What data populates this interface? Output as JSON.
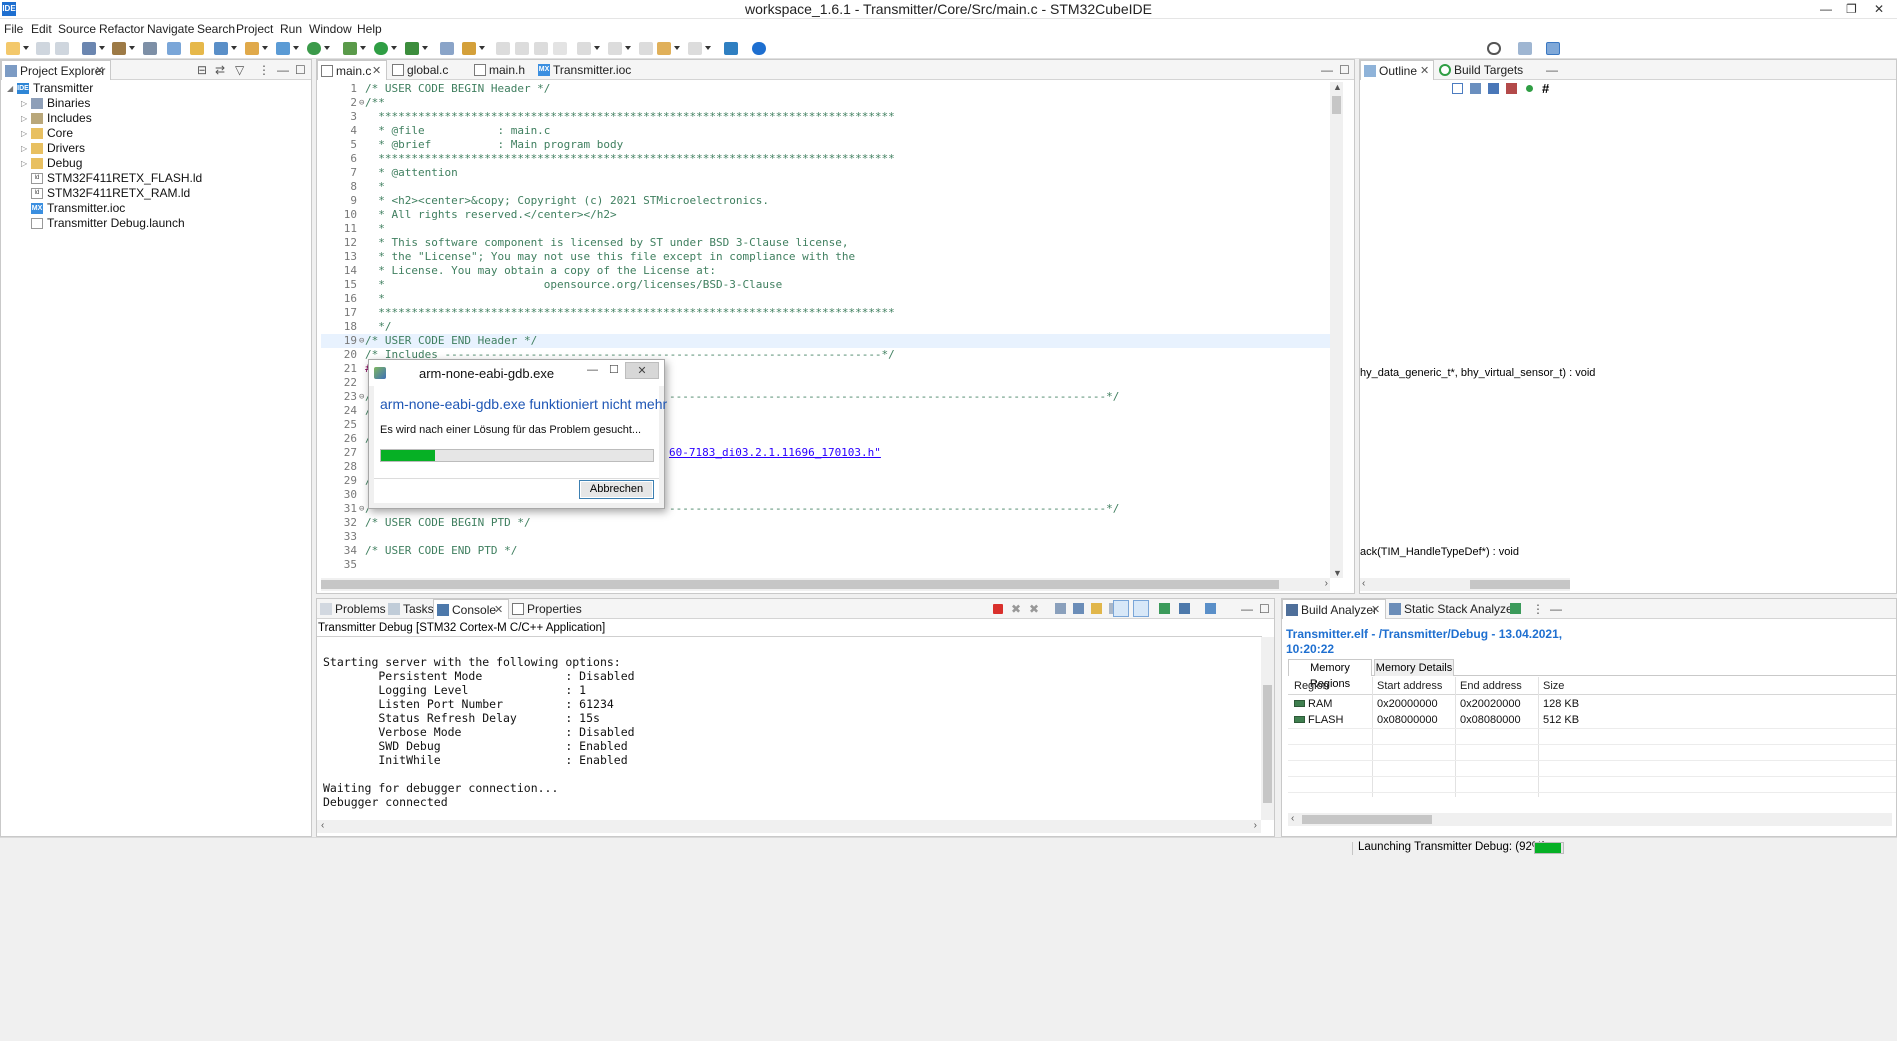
{
  "window": {
    "title": "workspace_1.6.1 - Transmitter/Core/Src/main.c - STM32CubeIDE",
    "app_icon": "IDE",
    "minimize": "—",
    "restore": "❐",
    "close": "✕"
  },
  "menu": [
    "File",
    "Edit",
    "Source",
    "Refactor",
    "Navigate",
    "Search",
    "Project",
    "Run",
    "Window",
    "Help"
  ],
  "project_explorer": {
    "tab": "Project Explorer",
    "items": [
      {
        "label": "Transmitter",
        "icon": "ide-project-icon",
        "badge": "IDE"
      },
      {
        "label": "Binaries",
        "icon": "binaries-icon"
      },
      {
        "label": "Includes",
        "icon": "includes-icon"
      },
      {
        "label": "Core",
        "icon": "folder-icon"
      },
      {
        "label": "Drivers",
        "icon": "folder-icon"
      },
      {
        "label": "Debug",
        "icon": "folder-icon"
      },
      {
        "label": "STM32F411RETX_FLASH.ld",
        "icon": "ld-file-icon",
        "badge": "ld"
      },
      {
        "label": "STM32F411RETX_RAM.ld",
        "icon": "ld-file-icon",
        "badge": "ld"
      },
      {
        "label": "Transmitter.ioc",
        "icon": "ioc-file-icon",
        "badge": "MX"
      },
      {
        "label": "Transmitter Debug.launch",
        "icon": "launch-file-icon"
      }
    ]
  },
  "editor": {
    "tabs": [
      "main.c",
      "global.c",
      "main.h",
      "Transmitter.ioc"
    ],
    "tab_badge": "MX",
    "lines": [
      {
        "n": "1",
        "t": "/* USER CODE BEGIN Header */"
      },
      {
        "n": "2",
        "t": "/**",
        "fold": "⊖"
      },
      {
        "n": "3",
        "t": "  ******************************************************************************"
      },
      {
        "n": "4",
        "t": "  * @file           : main.c"
      },
      {
        "n": "5",
        "t": "  * @brief          : Main program body"
      },
      {
        "n": "6",
        "t": "  ******************************************************************************"
      },
      {
        "n": "7",
        "t": "  * @attention"
      },
      {
        "n": "8",
        "t": "  *"
      },
      {
        "n": "9",
        "t": "  * <h2><center>&copy; Copyright (c) 2021 STMicroelectronics."
      },
      {
        "n": "10",
        "t": "  * All rights reserved.</center></h2>"
      },
      {
        "n": "11",
        "t": "  *"
      },
      {
        "n": "12",
        "t": "  * This software component is licensed by ST under BSD 3-Clause license,"
      },
      {
        "n": "13",
        "t": "  * the \"License\"; You may not use this file except in compliance with the"
      },
      {
        "n": "14",
        "t": "  * License. You may obtain a copy of the License at:"
      },
      {
        "n": "15",
        "t": "  *                        opensource.org/licenses/BSD-3-Clause"
      },
      {
        "n": "16",
        "t": "  *"
      },
      {
        "n": "17",
        "t": "  ******************************************************************************"
      },
      {
        "n": "18",
        "t": "  */"
      },
      {
        "n": "19",
        "t": "/* USER CODE END Header */",
        "fold": "⊖"
      },
      {
        "n": "20",
        "t": "/* Includes ------------------------------------------------------------------*/"
      },
      {
        "n": "21",
        "t": "#"
      },
      {
        "n": "22",
        "t": ""
      },
      {
        "n": "23",
        "t": "/",
        "tail": "------------------------------------------------------------------*/",
        "fold": "⊖"
      },
      {
        "n": "24",
        "t": "/"
      },
      {
        "n": "25",
        "t": ""
      },
      {
        "n": "26",
        "t": "/"
      },
      {
        "n": "27",
        "t": "",
        "tail": "60-7183_di03.2.1.11696_170103.h\""
      },
      {
        "n": "28",
        "t": ""
      },
      {
        "n": "29",
        "t": "/"
      },
      {
        "n": "30",
        "t": ""
      },
      {
        "n": "31",
        "t": "/",
        "tail": "------------------------------------------------------------------*/",
        "fold": "⊖"
      },
      {
        "n": "32",
        "t": "/* USER CODE BEGIN PTD */"
      },
      {
        "n": "33",
        "t": ""
      },
      {
        "n": "34",
        "t": "/* USER CODE END PTD */"
      },
      {
        "n": "35",
        "t": ""
      }
    ]
  },
  "outline": {
    "tabs": [
      "Outline",
      "Build Targets"
    ],
    "items": [
      "hy_data_generic_t*, bhy_virtual_sensor_t) : void",
      "ack(TIM_HandleTypeDef*) : void"
    ]
  },
  "console": {
    "tabs": [
      "Problems",
      "Tasks",
      "Console",
      "Properties"
    ],
    "header": "Transmitter Debug [STM32 Cortex-M C/C++ Application]",
    "lines": [
      "",
      "Starting server with the following options:",
      "        Persistent Mode            : Disabled",
      "        Logging Level              : 1",
      "        Listen Port Number         : 61234",
      "        Status Refresh Delay       : 15s",
      "        Verbose Mode               : Disabled",
      "        SWD Debug                  : Enabled",
      "        InitWhile                  : Enabled",
      "",
      "Waiting for debugger connection...",
      "Debugger connected"
    ]
  },
  "build_analyzer": {
    "tabs": [
      "Build Analyzer",
      "Static Stack Analyzer"
    ],
    "title_line1": "Transmitter.elf - /Transmitter/Debug - 13.04.2021,",
    "title_line2": "10:20:22",
    "subtabs": [
      "Memory Regions",
      "Memory Details"
    ],
    "columns": [
      "Region",
      "Start address",
      "End address",
      "Size"
    ],
    "rows": [
      {
        "region": "RAM",
        "start": "0x20000000",
        "end": "0x20020000",
        "size": "128 KB"
      },
      {
        "region": "FLASH",
        "start": "0x08000000",
        "end": "0x08080000",
        "size": "512 KB"
      }
    ]
  },
  "dialog": {
    "title": "arm-none-eabi-gdb.exe",
    "heading": "arm-none-eabi-gdb.exe funktioniert nicht mehr",
    "message": "Es wird nach einer Lösung für das Problem gesucht...",
    "progress": 0.2,
    "cancel_label": "Abbrechen",
    "minimize": "—",
    "maximize": "☐",
    "close": "✕"
  },
  "status": {
    "text": "Launching Transmitter Debug: (92%)",
    "progress": 0.92
  },
  "colors": {
    "comment": "#3f7f5f",
    "accent": "#1e6fd0",
    "progress_green": "#06b025"
  }
}
